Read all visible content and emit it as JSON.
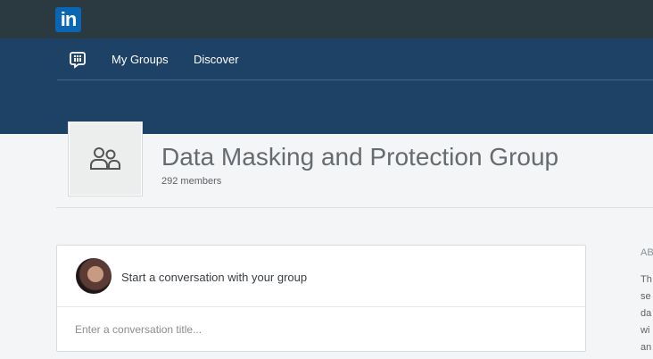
{
  "brand": {
    "logo_text": "in",
    "color": "#0a66b2"
  },
  "nav": {
    "icon": "groups-chat-icon",
    "items": [
      "My Groups",
      "Discover"
    ]
  },
  "group": {
    "title": "Data Masking and Protection Group",
    "members": "292 members",
    "logo_icon": "group-people-icon"
  },
  "composer": {
    "prompt": "Start a conversation with your group",
    "title_placeholder": "Enter a conversation title..."
  },
  "about": {
    "heading": "AB",
    "lines": [
      "Th",
      "se",
      "da",
      "wi",
      "an"
    ]
  },
  "colors": {
    "topbar": "#2b3a41",
    "groupbar": "#1e4266",
    "background": "#f4f5f6"
  }
}
